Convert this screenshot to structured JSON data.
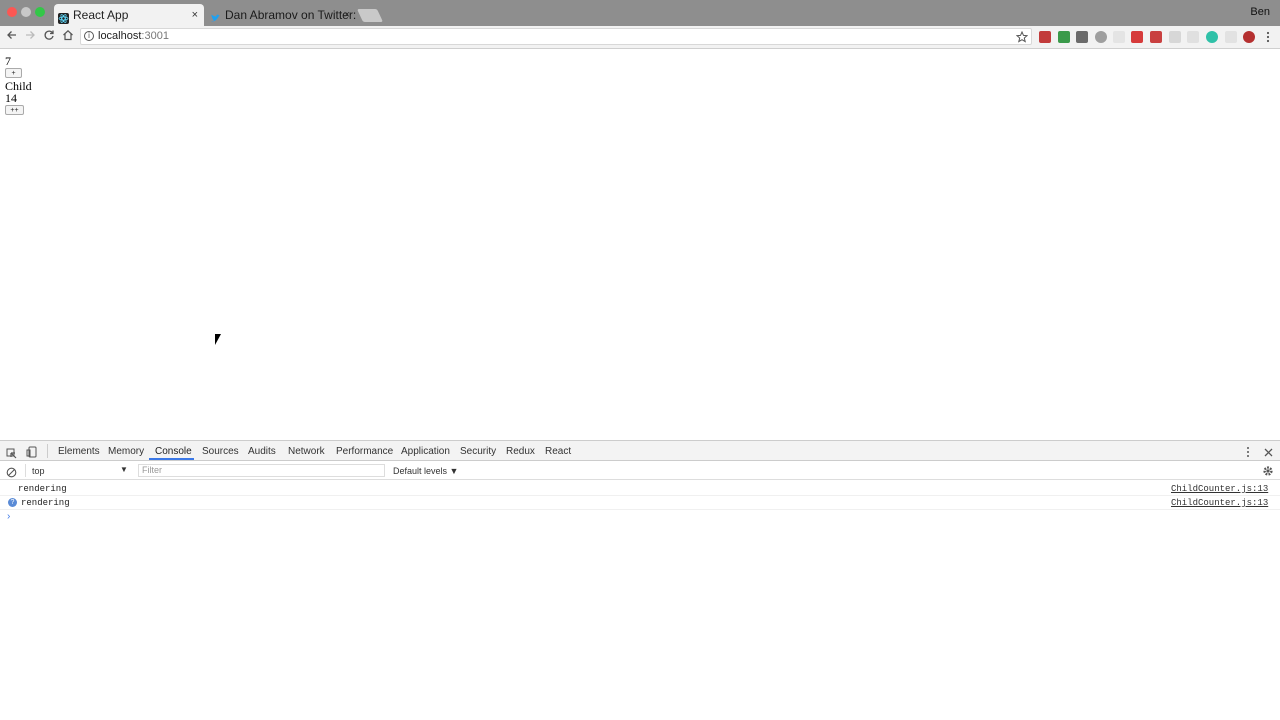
{
  "browser": {
    "tabs": [
      {
        "title": "React App",
        "close": "×"
      },
      {
        "title": "Dan Abramov on Twitter: \"Do",
        "close": "×"
      }
    ],
    "profile": "Ben",
    "url_host": "localhost",
    "url_port": ":3001",
    "info_glyph": "i"
  },
  "page": {
    "parent_count": "7",
    "parent_button": "+",
    "child_heading": "Child",
    "child_count": "14",
    "child_button": "++"
  },
  "devtools": {
    "tabs": [
      "Elements",
      "Memory",
      "Console",
      "Sources",
      "Audits",
      "Network",
      "Performance",
      "Application",
      "Security",
      "Redux",
      "React"
    ],
    "context": "top",
    "filter_placeholder": "Filter",
    "levels": "Default levels ▼",
    "logs": [
      {
        "text": "rendering",
        "source": "ChildCounter.js:13"
      },
      {
        "text": "rendering",
        "source": "ChildCounter.js:13"
      }
    ],
    "prompt": "›",
    "q_glyph": "?"
  },
  "colors": {
    "accent": "#3b78e7",
    "close": "#ff5f57",
    "min": "#febc2e",
    "max": "#28c840"
  }
}
